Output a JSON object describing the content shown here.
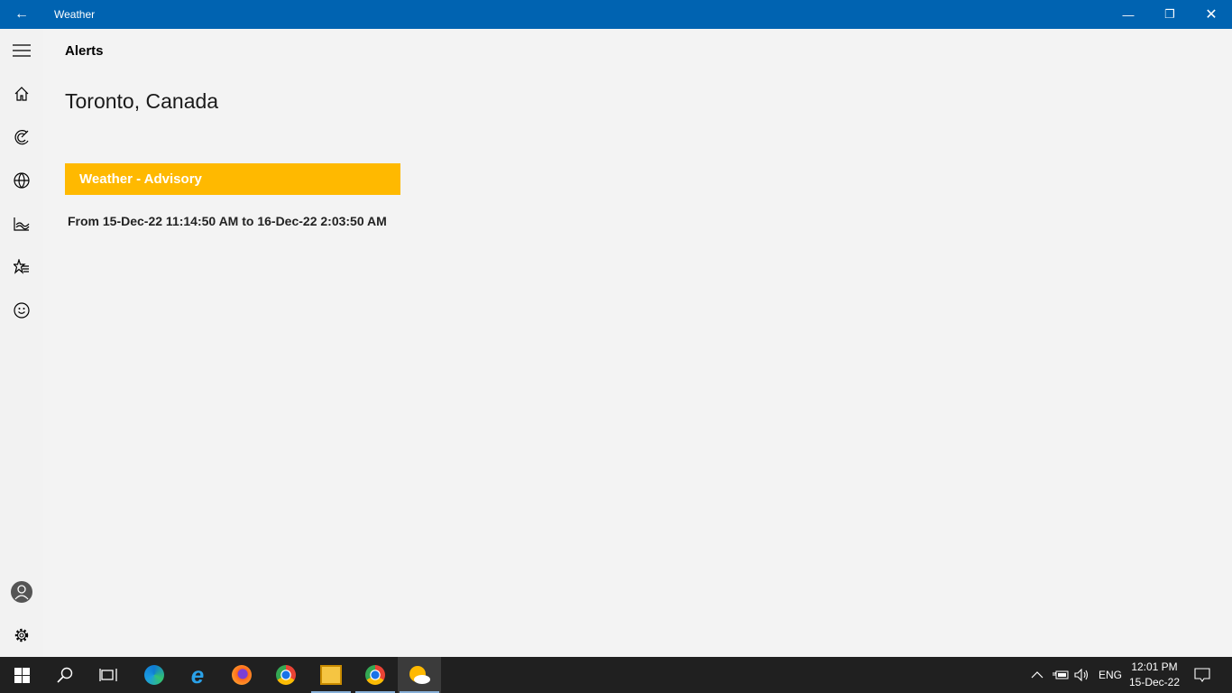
{
  "window": {
    "title": "Weather"
  },
  "header": {
    "section": "Alerts"
  },
  "location": "Toronto, Canada",
  "alert": {
    "title": "Weather - Advisory",
    "range": "From 15-Dec-22 11:14:50 AM to 16-Dec-22 2:03:50 AM",
    "color": "#ffb900"
  },
  "sidebar": {
    "items": [
      "home-icon",
      "radar-icon",
      "globe-icon",
      "historical-icon",
      "favorites-icon",
      "feedback-icon",
      "account-icon",
      "settings-icon"
    ]
  },
  "taskbar": {
    "lang": "ENG",
    "time": "12:01 PM",
    "date": "15-Dec-22"
  }
}
